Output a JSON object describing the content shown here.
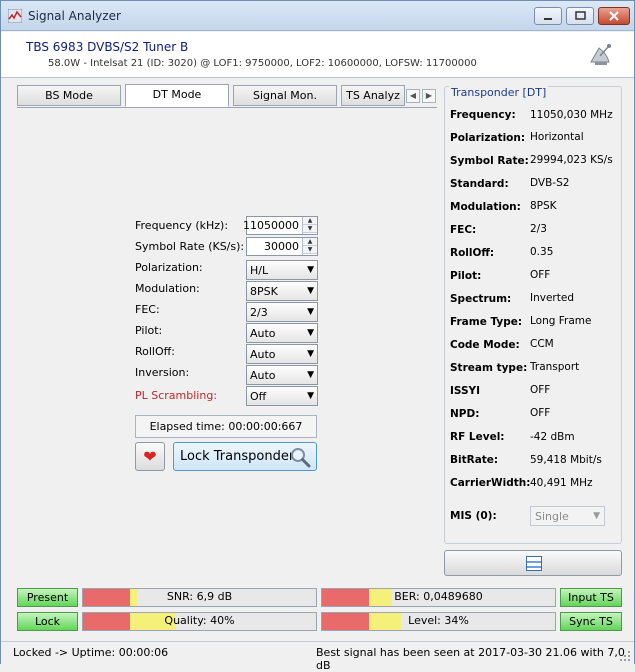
{
  "window": {
    "title": "Signal Analyzer"
  },
  "header": {
    "tuner": "TBS 6983 DVBS/S2 Tuner B",
    "satellite": "58.0W - Intelsat 21 (ID: 3020) @ LOF1: 9750000, LOF2: 10600000, LOFSW: 11700000"
  },
  "tabs": [
    "BS Mode",
    "DT Mode",
    "Signal Mon.",
    "TS Analyz"
  ],
  "form": {
    "frequency_label": "Frequency (kHz):",
    "frequency_value": "11050000",
    "symbol_rate_label": "Symbol Rate (KS/s):",
    "symbol_rate_value": "30000",
    "polarization_label": "Polarization:",
    "polarization_value": "H/L",
    "modulation_label": "Modulation:",
    "modulation_value": "8PSK",
    "fec_label": "FEC:",
    "fec_value": "2/3",
    "pilot_label": "Pilot:",
    "pilot_value": "Auto",
    "rolloff_label": "RollOff:",
    "rolloff_value": "Auto",
    "inversion_label": "Inversion:",
    "inversion_value": "Auto",
    "pl_scrambling_label": "PL Scrambling:",
    "pl_scrambling_value": "Off",
    "elapsed": "Elapsed time: 00:00:00:667",
    "lock_button": "Lock Transponder"
  },
  "transponder": {
    "title": "Transponder [DT]",
    "props": [
      {
        "key": "Frequency:",
        "value": "11050,030 MHz"
      },
      {
        "key": "Polarization:",
        "value": "Horizontal"
      },
      {
        "key": "Symbol Rate:",
        "value": "29994,023 KS/s"
      },
      {
        "key": "Standard:",
        "value": "DVB-S2"
      },
      {
        "key": "Modulation:",
        "value": "8PSK"
      },
      {
        "key": "FEC:",
        "value": "2/3"
      },
      {
        "key": "RollOff:",
        "value": "0.35"
      },
      {
        "key": "Pilot:",
        "value": "OFF"
      },
      {
        "key": "Spectrum:",
        "value": "Inverted"
      },
      {
        "key": "Frame Type:",
        "value": "Long Frame"
      },
      {
        "key": "Code Mode:",
        "value": "CCM"
      },
      {
        "key": "Stream type:",
        "value": "Transport"
      },
      {
        "key": "ISSYI",
        "value": "OFF"
      },
      {
        "key": "NPD:",
        "value": "OFF"
      },
      {
        "key": "RF Level:",
        "value": "-42 dBm"
      },
      {
        "key": "BitRate:",
        "value": "59,418 Mbit/s"
      },
      {
        "key": "CarrierWidth:",
        "value": "40,491 MHz"
      }
    ],
    "mis_label": "MIS (0):",
    "mis_value": "Single"
  },
  "indicators": {
    "present": "Present",
    "lock": "Lock",
    "input_ts": "Input TS",
    "sync_ts": "Sync TS",
    "snr": "SNR: 6,9 dB",
    "ber": "BER: 0,0489680",
    "quality": "Quality: 40%",
    "level": "Level: 34%",
    "snr_level": 0.23,
    "ber_level": 0.3,
    "quality_level": 0.4,
    "level_level": 0.34
  },
  "colors": {
    "red": "#e86a6a",
    "yellow": "#f5f07a",
    "green": "#63d45a",
    "title_blue": "#10207a"
  },
  "status": {
    "left": "Locked -> Uptime: 00:00:06",
    "right": "Best signal has been seen at 2017-03-30 21.06 with 7,0 dB"
  }
}
